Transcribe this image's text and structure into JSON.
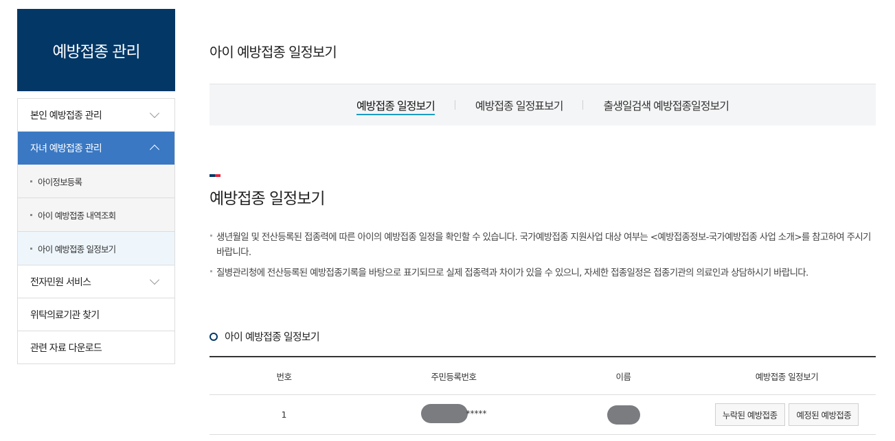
{
  "sidebar": {
    "title": "예방접종 관리",
    "items": [
      {
        "label": "본인 예방접종 관리"
      },
      {
        "label": "자녀 예방접종 관리"
      },
      {
        "label": "전자민원 서비스"
      },
      {
        "label": "위탁의료기관 찾기"
      },
      {
        "label": "관련 자료 다운로드"
      }
    ],
    "sub_items": [
      {
        "label": "아이정보등록"
      },
      {
        "label": "아이 예방접종 내역조회"
      },
      {
        "label": "아이 예방접종 일정보기"
      }
    ]
  },
  "main": {
    "page_title": "아이 예방접종 일정보기",
    "tabs": [
      {
        "label": "예방접종 일정보기"
      },
      {
        "label": "예방접종 일정표보기"
      },
      {
        "label": "출생일검색 예방접종일정보기"
      }
    ],
    "section_title": "예방접종 일정보기",
    "descriptions": [
      "생년월일 및 전산등록된 접종력에 따른 아이의 예방접종 일정을 확인할 수 있습니다. 국가예방접종 지원사업 대상 여부는 <예방접종정보-국가예방접종 사업 소개>를 참고하여 주시기 바랍니다.",
      "질병관리청에 전산등록된 예방접종기록을 바탕으로 표기되므로 실제 접종력과 차이가 있을 수 있으니, 자세한 접종일정은 접종기관의 의료인과 상담하시기 바랍니다."
    ],
    "sub_title": "아이 예방접종 일정보기",
    "table": {
      "headers": [
        "번호",
        "주민등록번호",
        "이름",
        "예방접종 일정보기"
      ],
      "rows": [
        {
          "no": "1",
          "ssn_suffix": "*****",
          "missed_label": "누락된 예방접종",
          "scheduled_label": "예정된 예방접종"
        }
      ]
    }
  },
  "colors": {
    "sidebar_header": "#023766",
    "active_menu": "#3a78c3",
    "tab_underline": "#1a9dc4",
    "accent_red": "#e1243a"
  }
}
